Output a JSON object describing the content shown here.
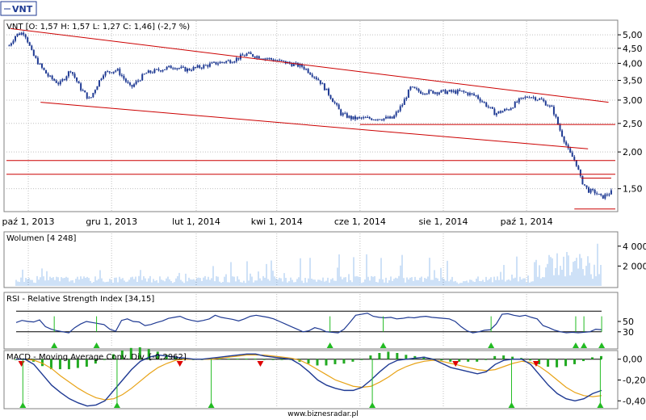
{
  "ticker": "VNT",
  "panels": {
    "price_title": "VNT [O: 1,57  H: 1,57  L: 1,27  C: 1,46] (-2,7 %)",
    "volume_title": "Wolumen [4 248]",
    "rsi_title": "RSI - Relative Strength Index [34,15]",
    "macd_title": "MACD - Moving Average Conv. Div. [-0,2962]"
  },
  "footer": "www.biznesradar.pl",
  "colors": {
    "candle": "#1f3a93",
    "trendline": "#cc0000",
    "volume": "#9ec3ef",
    "rsi": "#1f3a93",
    "macd_line": "#1f3a93",
    "signal_line": "#e8a317",
    "hist": "#22aa22",
    "buy": "#22bb22",
    "sell": "#dd0000",
    "grid": "#c0c0c0"
  },
  "chart_data": [
    {
      "type": "line",
      "panel": "price",
      "yscale": "log",
      "ylim": [
        1.27,
        5.5
      ],
      "yticks": [
        5.0,
        4.5,
        4.0,
        3.5,
        3.0,
        2.5,
        2.0,
        1.5
      ],
      "ytick_labels": [
        "5,00",
        "4,50",
        "4,00",
        "3,50",
        "3,00",
        "2,50",
        "2,00",
        "1,50"
      ],
      "xlim": [
        "2013-09-15",
        "2014-12-05"
      ],
      "xticks": [
        "2013-10-01",
        "2013-12-01",
        "2014-02-01",
        "2014-04-01",
        "2014-06-01",
        "2014-08-01",
        "2014-10-01"
      ],
      "xtick_labels": [
        "paź 1, 2013",
        "gru 1, 2013",
        "lut 1, 2014",
        "kwi 1, 2014",
        "cze 1, 2014",
        "sie 1, 2014",
        "paź 1, 2014"
      ],
      "price_anchors": [
        [
          "2013-09-17",
          4.6
        ],
        [
          "2013-09-22",
          5.0
        ],
        [
          "2013-09-28",
          5.1
        ],
        [
          "2013-10-04",
          4.3
        ],
        [
          "2013-10-10",
          3.9
        ],
        [
          "2013-10-16",
          3.6
        ],
        [
          "2013-10-24",
          3.4
        ],
        [
          "2013-11-01",
          3.8
        ],
        [
          "2013-11-08",
          3.3
        ],
        [
          "2013-11-15",
          3.0
        ],
        [
          "2013-11-25",
          3.7
        ],
        [
          "2013-12-05",
          3.8
        ],
        [
          "2013-12-15",
          3.3
        ],
        [
          "2013-12-26",
          3.7
        ],
        [
          "2014-01-05",
          3.8
        ],
        [
          "2014-01-15",
          3.9
        ],
        [
          "2014-01-25",
          3.8
        ],
        [
          "2014-02-05",
          3.9
        ],
        [
          "2014-02-15",
          4.0
        ],
        [
          "2014-02-28",
          4.1
        ],
        [
          "2014-03-10",
          4.3
        ],
        [
          "2014-03-20",
          4.2
        ],
        [
          "2014-03-31",
          4.1
        ],
        [
          "2014-04-10",
          4.0
        ],
        [
          "2014-04-20",
          3.9
        ],
        [
          "2014-05-02",
          3.5
        ],
        [
          "2014-05-10",
          3.1
        ],
        [
          "2014-05-18",
          2.7
        ],
        [
          "2014-05-26",
          2.6
        ],
        [
          "2014-06-05",
          2.6
        ],
        [
          "2014-06-15",
          2.6
        ],
        [
          "2014-06-25",
          2.6
        ],
        [
          "2014-07-02",
          2.9
        ],
        [
          "2014-07-08",
          3.3
        ],
        [
          "2014-07-15",
          3.2
        ],
        [
          "2014-07-25",
          3.2
        ],
        [
          "2014-08-05",
          3.2
        ],
        [
          "2014-08-15",
          3.2
        ],
        [
          "2014-08-25",
          3.1
        ],
        [
          "2014-09-01",
          2.9
        ],
        [
          "2014-09-08",
          2.7
        ],
        [
          "2014-09-18",
          2.8
        ],
        [
          "2014-09-26",
          3.0
        ],
        [
          "2014-10-03",
          3.1
        ],
        [
          "2014-10-12",
          3.0
        ],
        [
          "2014-10-20",
          2.8
        ],
        [
          "2014-10-25",
          2.4
        ],
        [
          "2014-11-01",
          2.0
        ],
        [
          "2014-11-06",
          1.85
        ],
        [
          "2014-11-10",
          1.6
        ],
        [
          "2014-11-15",
          1.48
        ],
        [
          "2014-11-20",
          1.46
        ],
        [
          "2014-11-25",
          1.4
        ],
        [
          "2014-12-02",
          1.46
        ]
      ],
      "last_bar": {
        "open": 1.57,
        "high": 1.57,
        "low": 1.27,
        "close": 1.46,
        "change_pct": -2.7
      },
      "trendlines": [
        {
          "from": [
            "2013-09-18",
            5.25
          ],
          "to": [
            "2014-11-30",
            2.95
          ]
        },
        {
          "from": [
            "2013-10-10",
            2.95
          ],
          "to": [
            "2014-11-15",
            2.05
          ]
        },
        {
          "from": [
            "2014-06-01",
            2.48
          ],
          "to": [
            "2014-12-05",
            2.48
          ]
        },
        {
          "from": [
            "2013-09-15",
            1.87
          ],
          "to": [
            "2014-12-05",
            1.87
          ]
        },
        {
          "from": [
            "2013-09-15",
            1.68
          ],
          "to": [
            "2014-12-05",
            1.68
          ]
        },
        {
          "from": [
            "2014-11-10",
            1.63
          ],
          "to": [
            "2014-12-02",
            1.63
          ]
        },
        {
          "from": [
            "2014-11-05",
            1.28
          ],
          "to": [
            "2014-12-05",
            1.28
          ]
        }
      ]
    },
    {
      "type": "bar",
      "panel": "volume",
      "ylim": [
        0,
        5200
      ],
      "yticks": [
        4000,
        2000
      ],
      "ytick_labels": [
        "4 000",
        "2 000"
      ],
      "last_value": 4248
    },
    {
      "type": "line",
      "panel": "rsi",
      "ylim": [
        0,
        100
      ],
      "yticks": [
        50,
        30
      ],
      "ytick_labels": [
        "50",
        "30"
      ],
      "levels": [
        70,
        30
      ],
      "last_value": 34.15,
      "values": [
        48,
        52,
        50,
        49,
        53,
        40,
        35,
        32,
        30,
        28,
        38,
        45,
        50,
        48,
        46,
        44,
        35,
        31,
        52,
        55,
        50,
        49,
        42,
        44,
        48,
        51,
        56,
        58,
        60,
        55,
        52,
        50,
        52,
        55,
        62,
        58,
        56,
        54,
        51,
        55,
        60,
        62,
        60,
        58,
        55,
        50,
        45,
        40,
        35,
        30,
        32,
        38,
        35,
        30,
        29,
        28,
        35,
        48,
        62,
        64,
        66,
        60,
        58,
        57,
        58,
        55,
        56,
        58,
        57,
        59,
        60,
        58,
        57,
        56,
        55,
        50,
        40,
        32,
        28,
        30,
        33,
        34,
        45,
        64,
        65,
        62,
        60,
        62,
        58,
        55,
        42,
        38,
        33,
        30,
        28,
        29,
        28,
        29,
        30,
        35,
        34
      ],
      "signals": [
        {
          "x": "2013-10-20",
          "kind": "buy"
        },
        {
          "x": "2013-11-20",
          "kind": "buy"
        },
        {
          "x": "2014-05-10",
          "kind": "buy"
        },
        {
          "x": "2014-06-18",
          "kind": "buy"
        },
        {
          "x": "2014-09-05",
          "kind": "buy"
        },
        {
          "x": "2014-11-06",
          "kind": "buy"
        },
        {
          "x": "2014-11-12",
          "kind": "buy"
        },
        {
          "x": "2014-11-25",
          "kind": "buy"
        }
      ]
    },
    {
      "type": "line",
      "panel": "macd",
      "ylim": [
        -0.46,
        0.06
      ],
      "yticks": [
        0.0,
        -0.2,
        -0.4
      ],
      "ytick_labels": [
        "0,00",
        "-0,20",
        "-0,40"
      ],
      "last_value": -0.2962,
      "macd": [
        0.0,
        0.0,
        -0.05,
        -0.15,
        -0.25,
        -0.32,
        -0.38,
        -0.42,
        -0.45,
        -0.44,
        -0.4,
        -0.3,
        -0.2,
        -0.1,
        -0.02,
        0.02,
        0.04,
        0.03,
        0.02,
        0.01,
        0.0,
        0.0,
        0.01,
        0.02,
        0.03,
        0.04,
        0.05,
        0.05,
        0.03,
        0.02,
        0.01,
        0.0,
        -0.05,
        -0.12,
        -0.2,
        -0.25,
        -0.28,
        -0.3,
        -0.3,
        -0.27,
        -0.2,
        -0.12,
        -0.05,
        -0.01,
        0.0,
        0.01,
        0.02,
        0.0,
        -0.04,
        -0.08,
        -0.1,
        -0.12,
        -0.14,
        -0.12,
        -0.05,
        -0.01,
        0.0,
        0.0,
        -0.05,
        -0.15,
        -0.25,
        -0.33,
        -0.38,
        -0.4,
        -0.38,
        -0.33,
        -0.3
      ],
      "signal": [
        0.0,
        0.0,
        -0.01,
        -0.04,
        -0.09,
        -0.16,
        -0.22,
        -0.28,
        -0.33,
        -0.37,
        -0.39,
        -0.38,
        -0.34,
        -0.28,
        -0.21,
        -0.14,
        -0.08,
        -0.04,
        -0.01,
        0.0,
        0.0,
        0.0,
        0.0,
        0.01,
        0.02,
        0.03,
        0.04,
        0.04,
        0.04,
        0.03,
        0.02,
        0.01,
        -0.01,
        -0.05,
        -0.1,
        -0.15,
        -0.2,
        -0.23,
        -0.26,
        -0.27,
        -0.26,
        -0.22,
        -0.17,
        -0.11,
        -0.07,
        -0.04,
        -0.02,
        -0.01,
        -0.02,
        -0.04,
        -0.06,
        -0.08,
        -0.1,
        -0.11,
        -0.1,
        -0.07,
        -0.04,
        -0.02,
        -0.03,
        -0.07,
        -0.13,
        -0.2,
        -0.27,
        -0.32,
        -0.35,
        -0.36,
        -0.35
      ],
      "signals": [
        {
          "x": "2013-09-26",
          "kind": "sell"
        },
        {
          "x": "2013-09-27",
          "kind": "buy"
        },
        {
          "x": "2013-12-05",
          "kind": "buy"
        },
        {
          "x": "2014-01-20",
          "kind": "sell"
        },
        {
          "x": "2014-02-12",
          "kind": "buy"
        },
        {
          "x": "2014-03-20",
          "kind": "sell"
        },
        {
          "x": "2014-06-10",
          "kind": "buy"
        },
        {
          "x": "2014-08-10",
          "kind": "sell"
        },
        {
          "x": "2014-09-20",
          "kind": "buy"
        },
        {
          "x": "2014-10-08",
          "kind": "sell"
        },
        {
          "x": "2014-11-24",
          "kind": "buy"
        }
      ]
    }
  ]
}
